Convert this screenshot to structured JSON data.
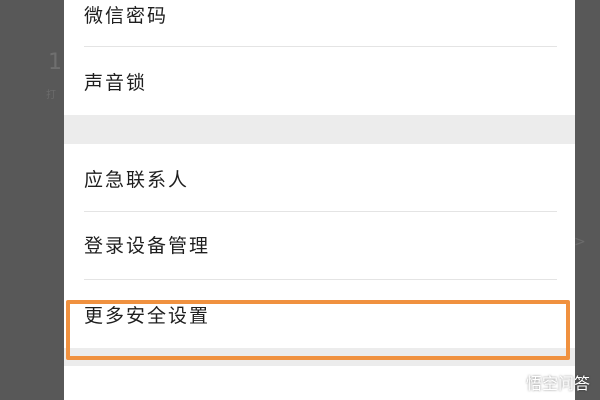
{
  "background": {
    "ghost_number": "1",
    "ghost_small": "打",
    "ghost_right": ">"
  },
  "menu": {
    "items": [
      {
        "label": "微信密码"
      },
      {
        "label": "声音锁"
      },
      {
        "label": "应急联系人"
      },
      {
        "label": "登录设备管理"
      },
      {
        "label": "更多安全设置"
      }
    ]
  },
  "highlight": {
    "color": "#f0913f",
    "target": "更多安全设置"
  },
  "watermark": {
    "text": "悟空问答"
  },
  "colors": {
    "panel": "#ffffff",
    "section_gap": "#ececec",
    "overlay": "#575757"
  }
}
